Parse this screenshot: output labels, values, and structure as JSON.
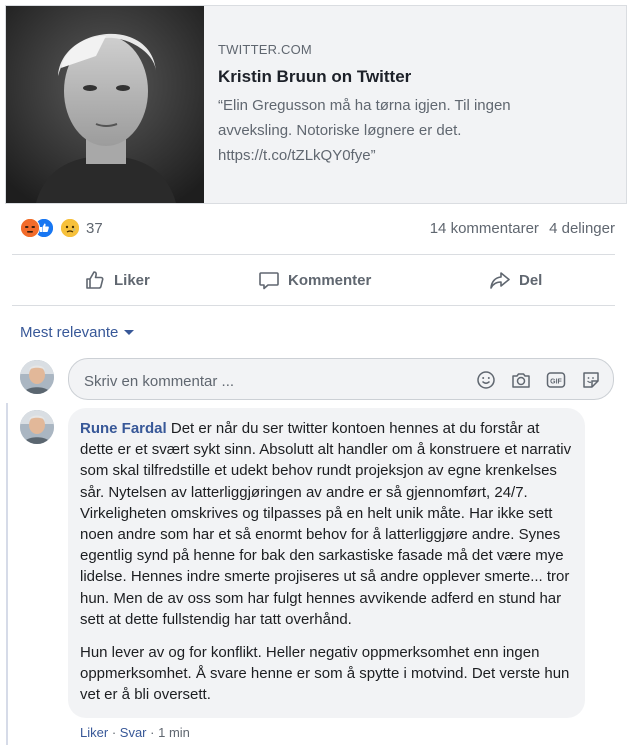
{
  "link_preview": {
    "domain": "TWITTER.COM",
    "title": "Kristin Bruun on Twitter",
    "description": "“Elin Gregusson må ha tørna igjen. Til ingen avveksling. Notoriske løgnere er det. https://t.co/tZLkQY0fye”"
  },
  "reactions": {
    "icons": [
      "angry-icon",
      "like-icon",
      "sad-icon"
    ],
    "count": "37",
    "comments": "14 kommentarer",
    "shares": "4 delinger"
  },
  "actions": {
    "like": "Liker",
    "comment": "Kommenter",
    "share": "Del"
  },
  "sort_label": "Mest relevante",
  "composer": {
    "placeholder": "Skriv en kommentar ...",
    "icons": [
      "emoji-icon",
      "camera-icon",
      "gif-icon",
      "sticker-icon"
    ]
  },
  "comment": {
    "author": "Rune Fardal",
    "text": "Det er når du ser twitter kontoen hennes at du forstår at dette er et svært sykt sinn. Absolutt alt handler om å konstruere et narrativ som skal tilfredstille et udekt behov rundt projeksjon av egne krenkelses sår. Nytelsen av latterliggjøringen av andre er så gjennomført, 24/7. Virkeligheten omskrives og tilpasses på en helt unik måte. Har ikke sett noen andre som har et så enormt behov for å latterliggjøre andre. Synes egentlig synd på henne for bak den sarkastiske fasade må det være mye lidelse. Hennes indre smerte projiseres ut så andre opplever smerte... tror hun. Men de av oss som har fulgt hennes avvikende adferd en stund har sett at dette fullstendig har tatt overhånd.",
    "text2": "Hun lever av og for konflikt. Heller negativ oppmerksomhet enn ingen oppmerksomhet. Å svare henne er som å spytte i motvind. Det verste hun vet er å bli oversett.",
    "like": "Liker",
    "dot": "·",
    "reply": "Svar",
    "time": "1 min"
  },
  "colors": {
    "link": "#385898",
    "muted": "#606770",
    "like_blue": "#1877f2",
    "angry": "#e9710f",
    "sad": "#f7b125"
  }
}
